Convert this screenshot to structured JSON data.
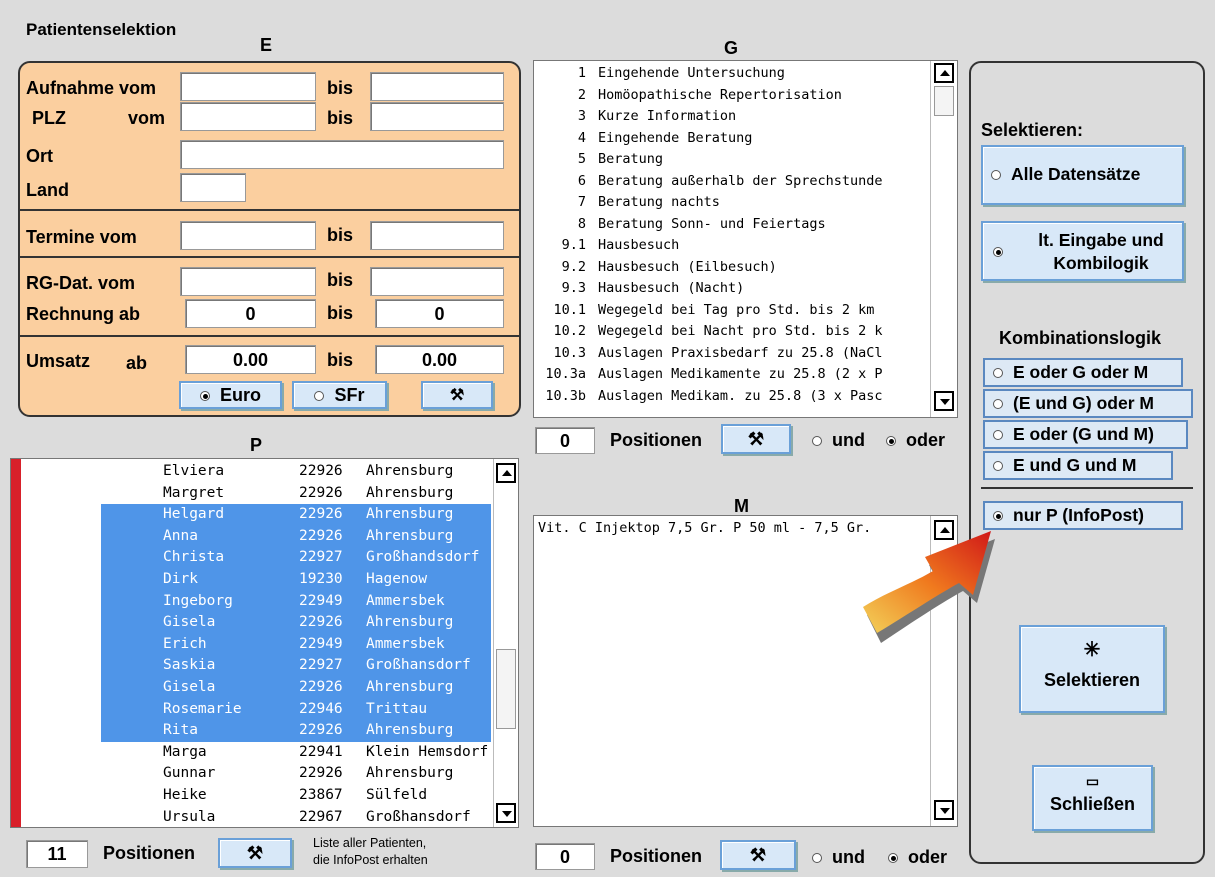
{
  "window_title": "Patientenselektion",
  "sections": {
    "E": "E",
    "G": "G",
    "P": "P",
    "M": "M"
  },
  "E": {
    "aufnahme_label": "Aufnahme vom",
    "plz_label": "PLZ",
    "vom": "vom",
    "bis": "bis",
    "ort_label": "Ort",
    "land_label": "Land",
    "termine_label": "Termine vom",
    "rgdat_label": "RG-Dat. vom",
    "rechnung_label": "Rechnung ab",
    "rechnung_from": "0",
    "rechnung_to": "0",
    "umsatz_label": "Umsatz",
    "ab": "ab",
    "umsatz_from": "0.00",
    "umsatz_to": "0.00",
    "euro_label": "Euro",
    "sfr_label": "SFr"
  },
  "G": {
    "items": [
      {
        "num": "1",
        "text": "Eingehende Untersuchung"
      },
      {
        "num": "2",
        "text": "Homöopathische Repertorisation"
      },
      {
        "num": "3",
        "text": "Kurze Information"
      },
      {
        "num": "4",
        "text": "Eingehende Beratung"
      },
      {
        "num": "5",
        "text": "Beratung"
      },
      {
        "num": "6",
        "text": "Beratung außerhalb der Sprechstunde"
      },
      {
        "num": "7",
        "text": "Beratung nachts"
      },
      {
        "num": "8",
        "text": "Beratung Sonn- und Feiertags"
      },
      {
        "num": "9.1",
        "text": "Hausbesuch"
      },
      {
        "num": "9.2",
        "text": "Hausbesuch (Eilbesuch)"
      },
      {
        "num": "9.3",
        "text": "Hausbesuch (Nacht)"
      },
      {
        "num": "10.1",
        "text": "Wegegeld bei Tag pro Std. bis 2 km"
      },
      {
        "num": "10.2",
        "text": "Wegegeld bei Nacht pro Std. bis 2 k"
      },
      {
        "num": "10.3",
        "text": "Auslagen Praxisbedarf zu 25.8 (NaCl"
      },
      {
        "num": "10.3a",
        "text": "Auslagen Medikamente zu 25.8 (2 x P"
      },
      {
        "num": "10.3b",
        "text": "Auslagen Medikam. zu 25.8 (3 x Pasc"
      }
    ],
    "count": "0",
    "positions_label": "Positionen",
    "und": "und",
    "oder": "oder"
  },
  "P": {
    "patients": [
      {
        "name": "Elviera",
        "plz": "22926",
        "city": "Ahrensburg",
        "selected": false
      },
      {
        "name": "Margret",
        "plz": "22926",
        "city": "Ahrensburg",
        "selected": false
      },
      {
        "name": "Helgard",
        "plz": "22926",
        "city": "Ahrensburg",
        "selected": true
      },
      {
        "name": "Anna",
        "plz": "22926",
        "city": "Ahrensburg",
        "selected": true
      },
      {
        "name": "Christa",
        "plz": "22927",
        "city": "Großhandsdorf",
        "selected": true
      },
      {
        "name": "Dirk",
        "plz": "19230",
        "city": "Hagenow",
        "selected": true
      },
      {
        "name": "Ingeborg",
        "plz": "22949",
        "city": "Ammersbek",
        "selected": true
      },
      {
        "name": "Gisela",
        "plz": "22926",
        "city": "Ahrensburg",
        "selected": true
      },
      {
        "name": "Erich",
        "plz": "22949",
        "city": "Ammersbek",
        "selected": true
      },
      {
        "name": "Saskia",
        "plz": "22927",
        "city": "Großhansdorf",
        "selected": true
      },
      {
        "name": "Gisela",
        "plz": "22926",
        "city": "Ahrensburg",
        "selected": true
      },
      {
        "name": "Rosemarie",
        "plz": "22946",
        "city": "Trittau",
        "selected": true
      },
      {
        "name": "Rita",
        "plz": "22926",
        "city": "Ahrensburg",
        "selected": true
      },
      {
        "name": "Marga",
        "plz": "22941",
        "city": "Klein Hemsdorf",
        "selected": false
      },
      {
        "name": "Gunnar",
        "plz": "22926",
        "city": "Ahrensburg",
        "selected": false
      },
      {
        "name": "Heike",
        "plz": "23867",
        "city": "Sülfeld",
        "selected": false
      },
      {
        "name": "Ursula",
        "plz": "22967",
        "city": "Großhansdorf",
        "selected": false
      }
    ],
    "count": "11",
    "positions_label": "Positionen",
    "note_line1": "Liste aller Patienten,",
    "note_line2": "die InfoPost erhalten"
  },
  "M": {
    "items": [
      "Vit. C Injektop 7,5 Gr. P  50 ml - 7,5 Gr."
    ],
    "count": "0",
    "positions_label": "Positionen",
    "und": "und",
    "oder": "oder"
  },
  "right": {
    "selektieren_label": "Selektieren:",
    "alle_label": "Alle Datensätze",
    "eingabe_line1": "lt. Eingabe und",
    "eingabe_line2": "Kombilogik",
    "kombi_label": "Kombinationslogik",
    "kombi_options": [
      "E oder G oder M",
      "(E und G) oder M",
      "E oder (G und M)",
      "E und G und M"
    ],
    "infopost_label": "nur P (InfoPost)",
    "selektieren_button": "Selektieren",
    "schliessen_button": "Schließen"
  },
  "colors": {
    "panel_e": "#fbcf9f",
    "selection": "#4f95e8",
    "button_border": "#6aa0d8"
  }
}
